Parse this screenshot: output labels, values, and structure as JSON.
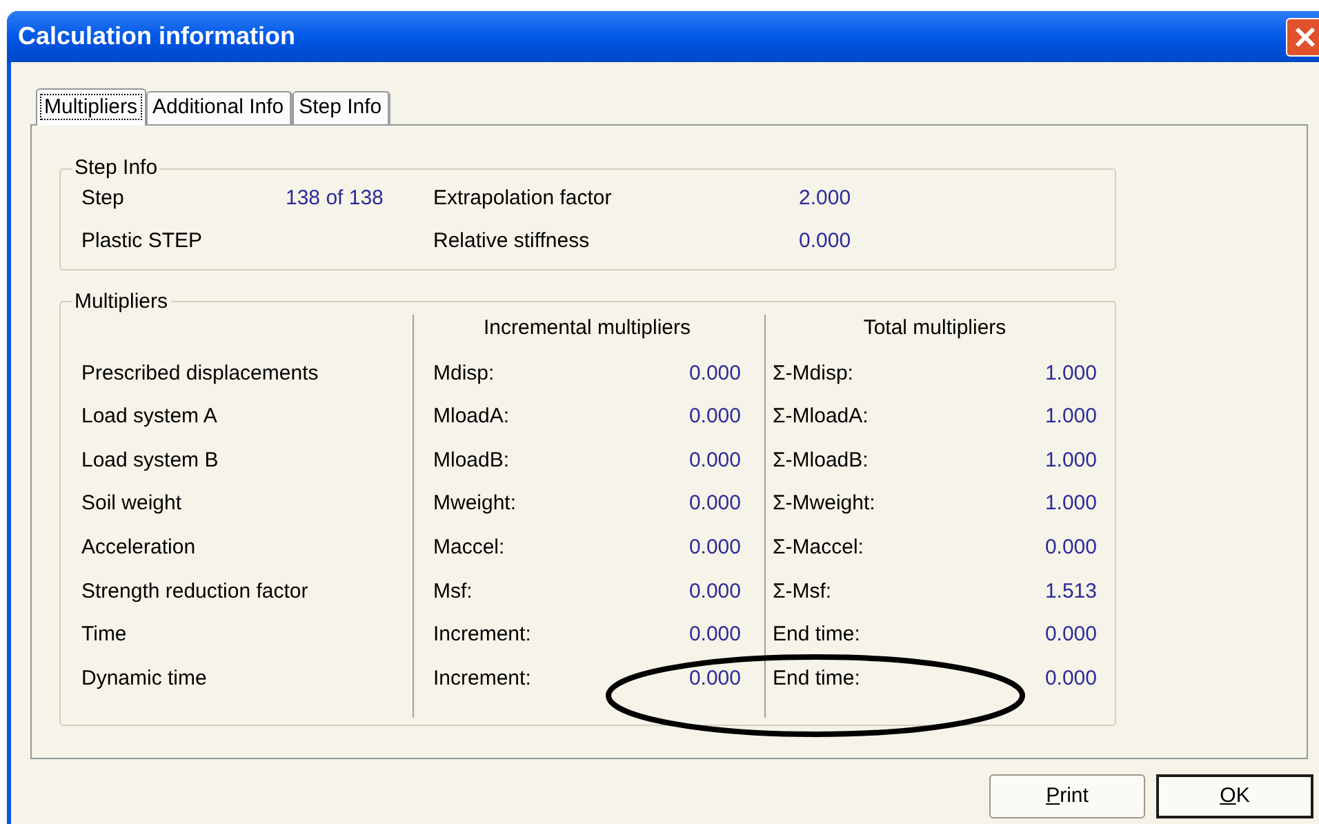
{
  "window": {
    "title": "Calculation information"
  },
  "tabs": [
    {
      "label": "Multipliers",
      "selected": true
    },
    {
      "label": "Additional Info",
      "selected": false
    },
    {
      "label": "Step Info",
      "selected": false
    }
  ],
  "step_info": {
    "title": "Step Info",
    "rows": [
      {
        "label": "Step",
        "value": "138 of 138",
        "label_2": "Extrapolation factor",
        "value_2": "2.000"
      },
      {
        "label": "Plastic STEP",
        "label_2": "Relative stiffness",
        "value_2": "0.000"
      }
    ]
  },
  "multipliers": {
    "title": "Multipliers",
    "incremental_header": "Incremental multipliers",
    "total_header": "Total multipliers",
    "rows": [
      {
        "name": "Prescribed displacements",
        "incremental_label": "Mdisp:",
        "incremental_value": "0.000",
        "total_label": "Σ-Mdisp:",
        "total_value": "1.000"
      },
      {
        "name": "Load system A",
        "incremental_label": "MloadA:",
        "incremental_value": "0.000",
        "total_label": "Σ-MloadA:",
        "total_value": "1.000"
      },
      {
        "name": "Load system B",
        "incremental_label": "MloadB:",
        "incremental_value": "0.000",
        "total_label": "Σ-MloadB:",
        "total_value": "1.000"
      },
      {
        "name": "Soil weight",
        "incremental_label": "Mweight:",
        "incremental_value": "0.000",
        "total_label": "Σ-Mweight:",
        "total_value": "1.000"
      },
      {
        "name": "Acceleration",
        "incremental_label": "Maccel:",
        "incremental_value": "0.000",
        "total_label": "Σ-Maccel:",
        "total_value": "0.000"
      },
      {
        "name": "Strength reduction factor",
        "incremental_label": "Msf:",
        "incremental_value": "0.000",
        "total_label": "Σ-Msf:",
        "total_value": "1.513"
      },
      {
        "name": "Time",
        "incremental_label": "Increment:",
        "incremental_value": "0.000",
        "total_label": "End time:",
        "total_value": "0.000"
      },
      {
        "name": "Dynamic time",
        "incremental_label": "Increment:",
        "incremental_value": "0.000",
        "total_label": "End time:",
        "total_value": "0.000"
      }
    ]
  },
  "annotation": {
    "kind": "ellipse"
  },
  "buttons": [
    {
      "label": "Print",
      "default": false
    },
    {
      "label": "OK",
      "default": true
    }
  ]
}
